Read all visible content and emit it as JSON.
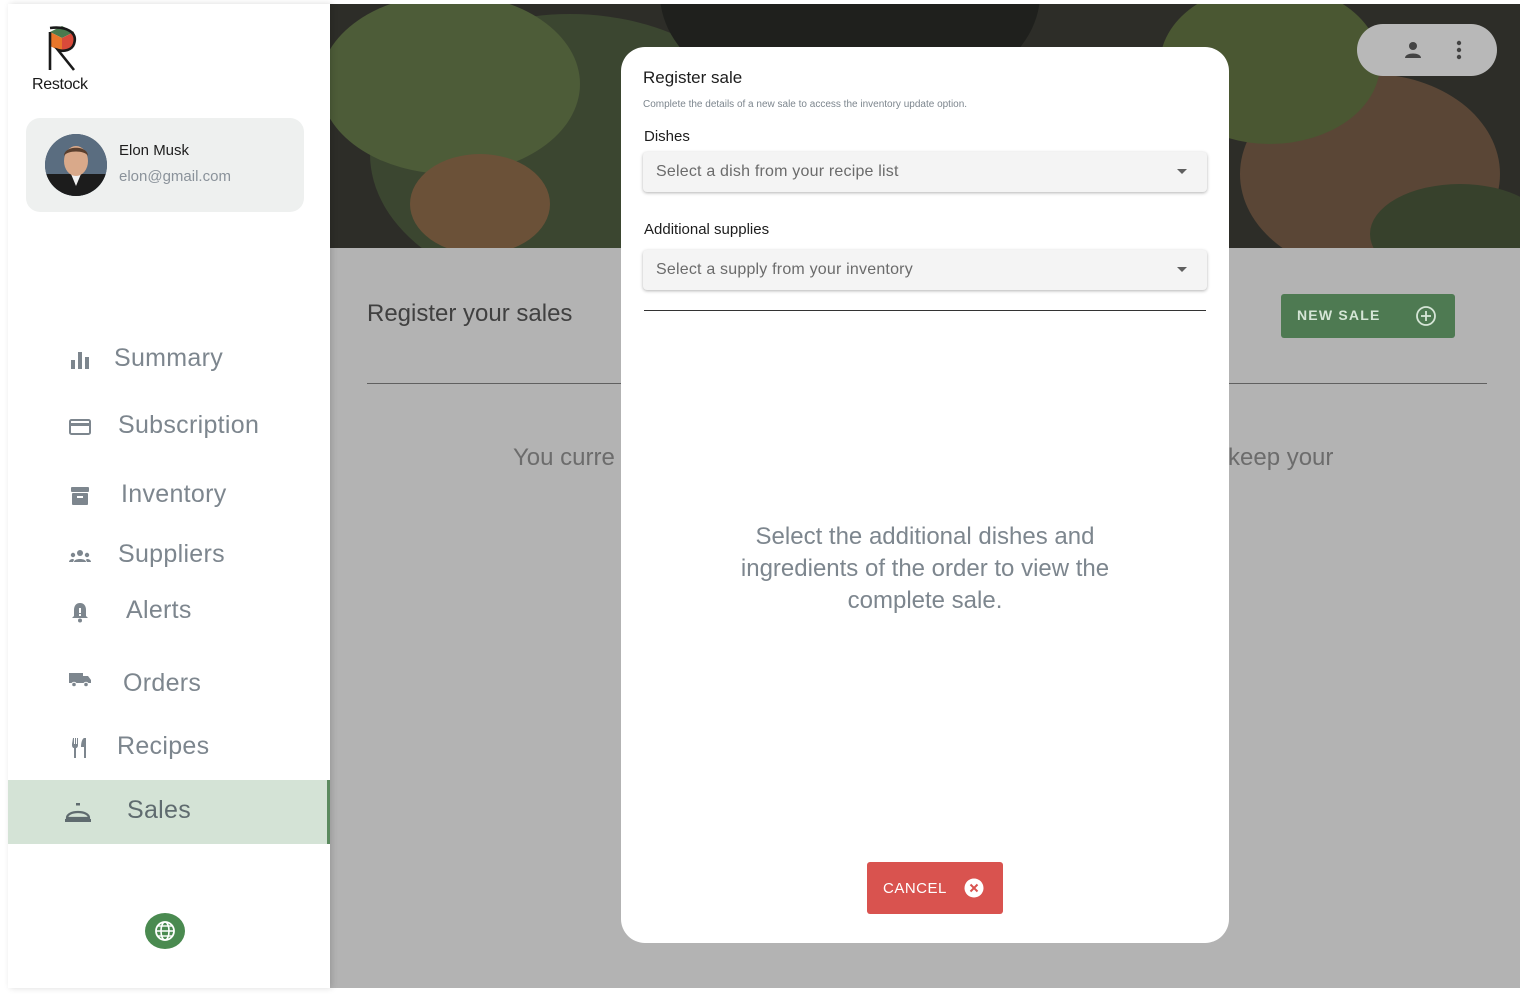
{
  "app": {
    "name": "Restock"
  },
  "profile": {
    "name": "Elon Musk",
    "email": "elon@gmail.com"
  },
  "nav": {
    "items": [
      {
        "label": "Summary",
        "icon": "bar-chart-icon"
      },
      {
        "label": "Subscription",
        "icon": "credit-card-icon"
      },
      {
        "label": "Inventory",
        "icon": "archive-box-icon"
      },
      {
        "label": "Suppliers",
        "icon": "group-icon"
      },
      {
        "label": "Alerts",
        "icon": "bell-alert-icon"
      },
      {
        "label": "Orders",
        "icon": "truck-icon"
      },
      {
        "label": "Recipes",
        "icon": "fork-knife-icon"
      },
      {
        "label": "Sales",
        "icon": "cloche-icon",
        "active": true
      }
    ]
  },
  "main": {
    "title": "Register your sales",
    "new_sale_label": "NEW SALE",
    "empty_left": "You curre",
    "empty_right": "keep your"
  },
  "modal": {
    "title": "Register sale",
    "subtitle": "Complete the details of a new sale to access the inventory update option.",
    "dishes_label": "Dishes",
    "dishes_placeholder": "Select a dish from your recipe list",
    "supplies_label": "Additional supplies",
    "supplies_placeholder": "Select a supply from your inventory",
    "message": "Select the additional dishes and ingredients of the order to view the complete sale.",
    "cancel_label": "CANCEL"
  },
  "colors": {
    "accent_green": "#4e7a52",
    "active_nav_bg": "#d4e3d6",
    "cancel_red": "#d9534f"
  }
}
